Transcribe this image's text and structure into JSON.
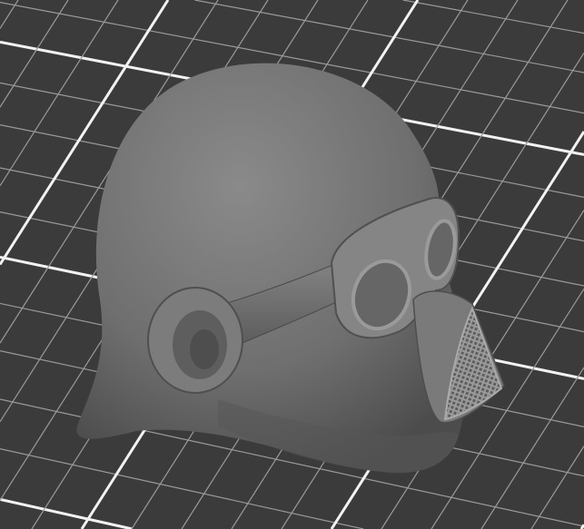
{
  "viewport": {
    "colors": {
      "background": "#3b3b3b",
      "grid_minor": "#9a9a9a",
      "grid_major": "#f2f2f2",
      "model": "#7a7a7a"
    }
  }
}
